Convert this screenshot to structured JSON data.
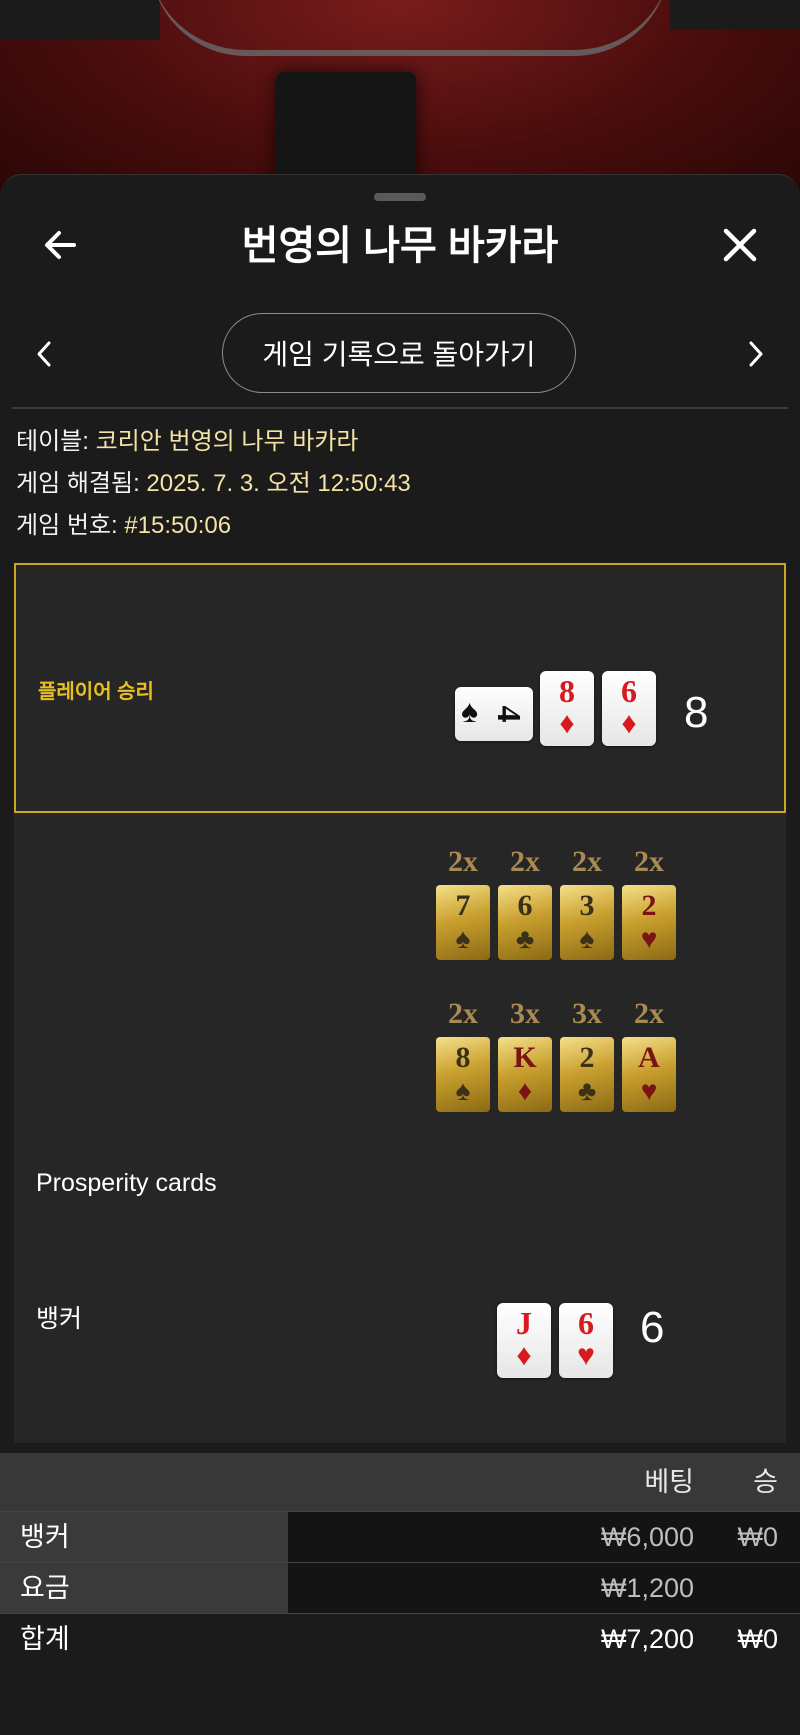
{
  "header": {
    "title": "번영의 나무 바카라"
  },
  "nav": {
    "back_to_history": "게임 기록으로 돌아가기"
  },
  "info": {
    "table_label": "테이블:",
    "table_value": "코리안 번영의 나무 바카라",
    "resolved_label": "게임 해결됨:",
    "resolved_value": "2025. 7. 3. 오전 12:50:43",
    "game_no_label": "게임 번호:",
    "game_no_value": "#15:50:06"
  },
  "player": {
    "label": "플레이어 승리",
    "score": "8",
    "cards": [
      {
        "rank": "4",
        "suit": "♠",
        "color": "black",
        "rotated": true
      },
      {
        "rank": "8",
        "suit": "♦",
        "color": "red"
      },
      {
        "rank": "6",
        "suit": "♦",
        "color": "red"
      }
    ]
  },
  "prosperity": {
    "label": "Prosperity cards",
    "row1": [
      {
        "mult": "2x",
        "rank": "7",
        "suit": "♠",
        "color": "dark"
      },
      {
        "mult": "2x",
        "rank": "6",
        "suit": "♣",
        "color": "dark"
      },
      {
        "mult": "2x",
        "rank": "3",
        "suit": "♠",
        "color": "dark"
      },
      {
        "mult": "2x",
        "rank": "2",
        "suit": "♥",
        "color": "red"
      }
    ],
    "row2": [
      {
        "mult": "2x",
        "rank": "8",
        "suit": "♠",
        "color": "dark"
      },
      {
        "mult": "3x",
        "rank": "K",
        "suit": "♦",
        "color": "red"
      },
      {
        "mult": "3x",
        "rank": "2",
        "suit": "♣",
        "color": "dark"
      },
      {
        "mult": "2x",
        "rank": "A",
        "suit": "♥",
        "color": "red"
      }
    ]
  },
  "banker": {
    "label": "뱅커",
    "score": "6",
    "cards": [
      {
        "rank": "J",
        "suit": "♦",
        "color": "red"
      },
      {
        "rank": "6",
        "suit": "♥",
        "color": "red"
      }
    ]
  },
  "bets": {
    "col_bet": "베팅",
    "col_win": "승",
    "rows": [
      {
        "name": "뱅커",
        "bet": "₩6,000",
        "win": "₩0"
      },
      {
        "name": "요금",
        "bet": "₩1,200",
        "win": ""
      }
    ],
    "total": {
      "name": "합계",
      "bet": "₩7,200",
      "win": "₩0"
    }
  },
  "colors": {
    "accent_gold": "#e8c020",
    "card_red": "#d71920",
    "info_value": "#f3e3a4"
  }
}
